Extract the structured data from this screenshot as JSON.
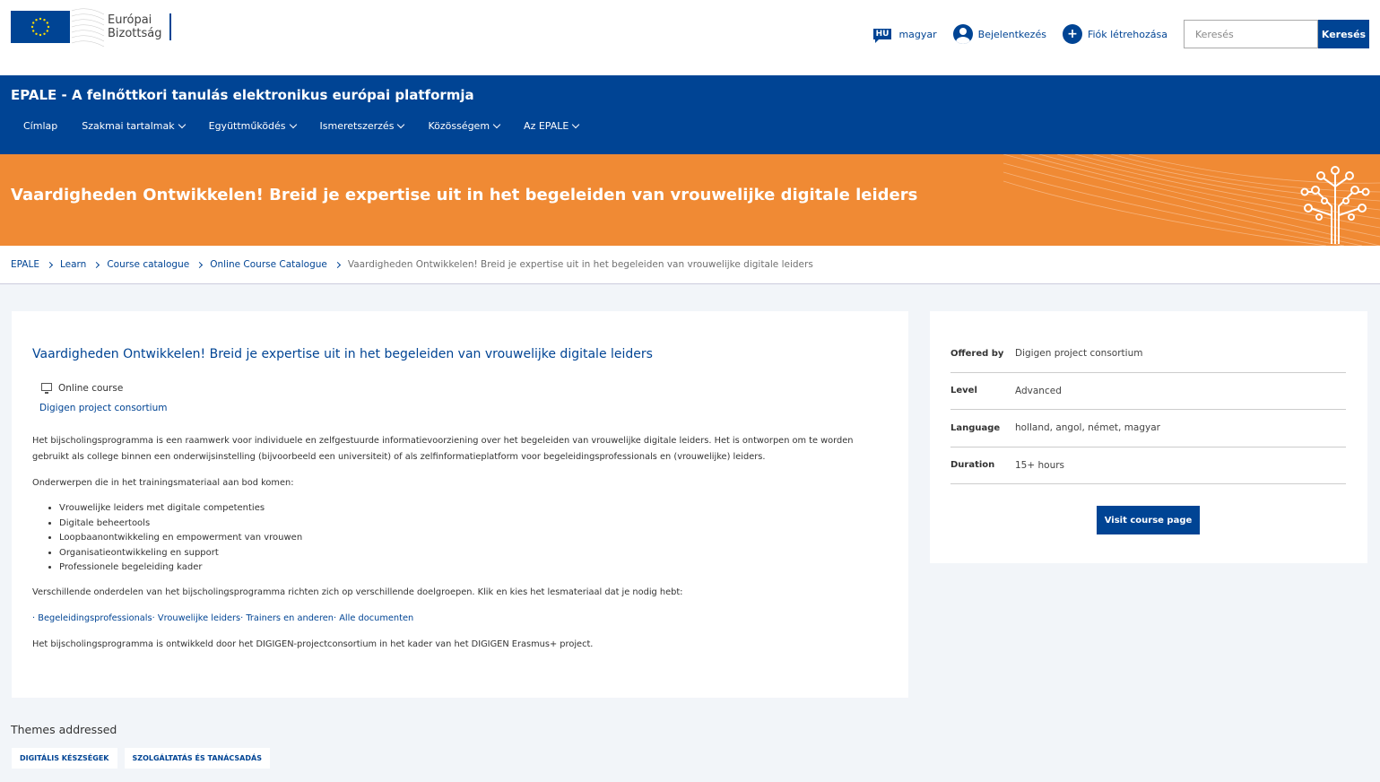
{
  "header": {
    "logo_line1": "Európai",
    "logo_line2": "Bizottság",
    "lang_code": "HU",
    "lang_label": "magyar",
    "login_label": "Bejelentkezés",
    "register_label": "Fiók létrehozása",
    "search_placeholder": "Keresés",
    "search_button": "Keresés"
  },
  "site": {
    "title": "EPALE - A felnőttkori tanulás elektronikus európai platformja",
    "nav": [
      {
        "label": "Címlap"
      },
      {
        "label": "Szakmai tartalmak"
      },
      {
        "label": "Együttműködés"
      },
      {
        "label": "Ismeretszerzés"
      },
      {
        "label": "Közösségem"
      },
      {
        "label": "Az EPALE"
      }
    ]
  },
  "banner": {
    "title": "Vaardigheden Ontwikkelen! Breid je expertise uit in het begeleiden van vrouwelijke digitale leiders"
  },
  "breadcrumb": {
    "items": [
      "EPALE",
      "Learn",
      "Course catalogue",
      "Online Course Catalogue"
    ],
    "current": "Vaardigheden Ontwikkelen! Breid je expertise uit in het begeleiden van vrouwelijke digitale leiders"
  },
  "course": {
    "title": "Vaardigheden Ontwikkelen! Breid je expertise uit in het begeleiden van vrouwelijke digitale leiders",
    "type": "Online course",
    "provider": "Digigen project consortium",
    "intro": "Het bijscholingsprogramma is een raamwerk voor individuele en zelfgestuurde informatievoorziening over het begeleiden van vrouwelijke digitale leiders. Het is ontworpen om te worden gebruikt als college binnen een onderwijsinstelling (bijvoorbeeld een universiteit) of als zelfinformatieplatform voor begeleidingsprofessionals en (vrouwelijke) leiders.",
    "topics_intro": "Onderwerpen die in het trainingsmateriaal aan bod komen:",
    "topics": [
      "Vrouwelijke leiders met digitale competenties",
      "Digitale beheertools",
      "Loopbaanontwikkeling en empowerment van vrouwen",
      "Organisatieontwikkeling en support",
      "Professionele begeleiding kader"
    ],
    "audience_text": "Verschillende onderdelen van het bijscholingsprogramma richten zich op verschillende doelgroepen. Klik en kies het lesmateriaal dat je nodig hebt:",
    "audience_links": [
      "Begeleidingsprofessionals",
      "Vrouwelijke leiders",
      "Trainers en anderen",
      "Alle documenten"
    ],
    "footer_text": "Het bijscholingsprogramma is ontwikkeld door het DIGIGEN-projectconsortium in het kader van het DIGIGEN Erasmus+ project."
  },
  "details": {
    "rows": [
      {
        "key": "Offered by",
        "value": "Digigen project consortium"
      },
      {
        "key": "Level",
        "value": "Advanced"
      },
      {
        "key": "Language",
        "value": "holland, angol, német, magyar"
      },
      {
        "key": "Duration",
        "value": "15+ hours"
      }
    ],
    "visit_button": "Visit course page"
  },
  "themes": {
    "title": "Themes addressed",
    "chips": [
      "DIGITÁLIS KÉSZSÉGEK",
      "SZOLGÁLTATÁS ÉS TANÁCSADÁS"
    ]
  },
  "colors": {
    "brand_blue": "#004494",
    "banner_orange": "#f08a34",
    "page_bg": "#f2f5f9"
  }
}
